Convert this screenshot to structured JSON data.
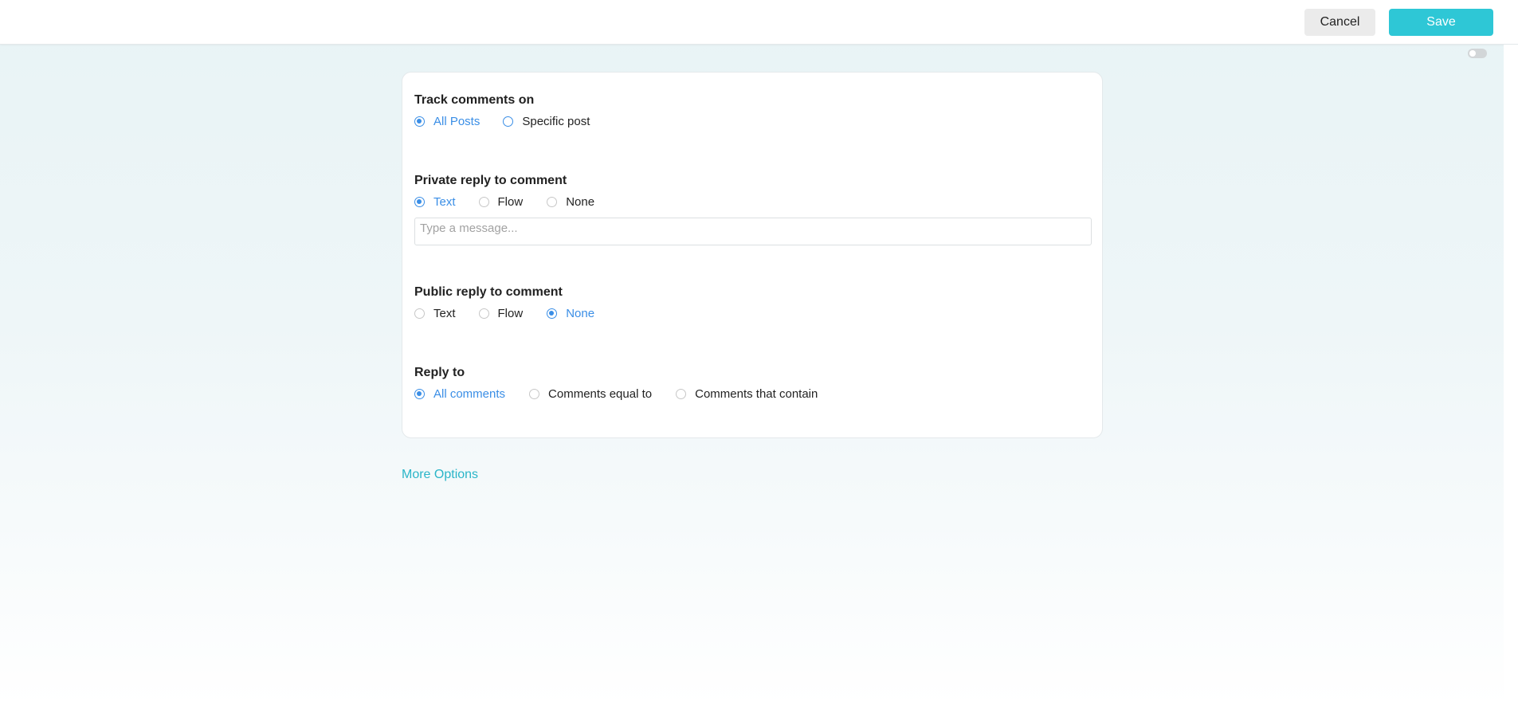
{
  "toolbar": {
    "cancel_label": "Cancel",
    "save_label": "Save"
  },
  "colors": {
    "accent": "#2ec7d6",
    "selected_radio": "#3a8ee6",
    "link": "#2ab5c8"
  },
  "track_comments": {
    "title": "Track comments on",
    "options": [
      "All Posts",
      "Specific post"
    ],
    "selected": "All Posts"
  },
  "private_reply": {
    "title": "Private reply to comment",
    "options": [
      "Text",
      "Flow",
      "None"
    ],
    "selected": "Text",
    "message_placeholder": "Type a message...",
    "message_value": ""
  },
  "public_reply": {
    "title": "Public reply to comment",
    "options": [
      "Text",
      "Flow",
      "None"
    ],
    "selected": "None"
  },
  "reply_to": {
    "title": "Reply to",
    "options": [
      "All comments",
      "Comments equal to",
      "Comments that contain"
    ],
    "selected": "All comments"
  },
  "more_options_label": "More Options"
}
